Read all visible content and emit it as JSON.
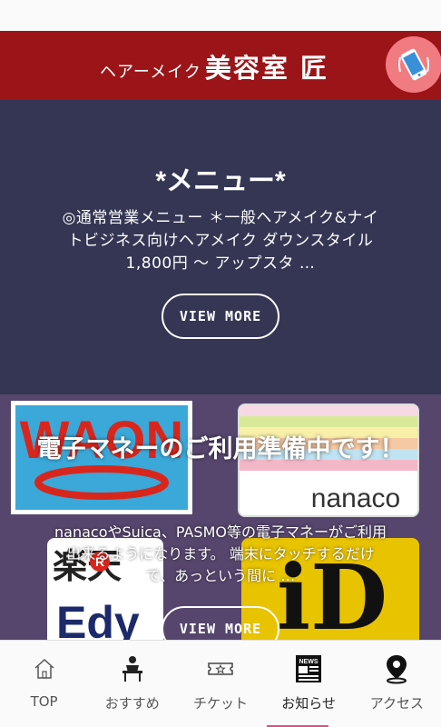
{
  "header": {
    "logo_small": "ヘアーメイク",
    "logo_big": "美容室 匠",
    "phone_icon": "phone-icon"
  },
  "menu": {
    "title": "*メニュー*",
    "description": "◎通常営業メニュー ＊一般ヘアメイク&ナイトビジネス向けヘアメイク ダウンスタイル　1,800円 〜 アップスタ …",
    "button": "VIEW MORE"
  },
  "emoney": {
    "title": "電子マネーのご利用準備中です！",
    "description": "nanacoやSuica、PASMO等の電子マネーがご利用出来るようになります。 端末にタッチするだけで、あっという間に …",
    "button": "VIEW MORE",
    "cards": {
      "waon": "WAON",
      "nanaco": "nanaco",
      "edy_top": "楽天",
      "edy_badge": "R",
      "edy": "Edy",
      "id": "iD"
    }
  },
  "nav": {
    "active_index": 3,
    "items": [
      {
        "label": "TOP",
        "icon": "home-icon"
      },
      {
        "label": "おすすめ",
        "icon": "recommend-icon"
      },
      {
        "label": "チケット",
        "icon": "ticket-icon"
      },
      {
        "label": "お知らせ",
        "icon": "news-icon"
      },
      {
        "label": "アクセス",
        "icon": "map-pin-icon"
      }
    ],
    "news_badge_text": "NEWS"
  },
  "colors": {
    "header_bg": "#9b1518",
    "menu_bg": "#343654",
    "emoney_bg": "#56466d",
    "phone_btn": "#f07b80",
    "active_bar": "#e64a8a"
  }
}
